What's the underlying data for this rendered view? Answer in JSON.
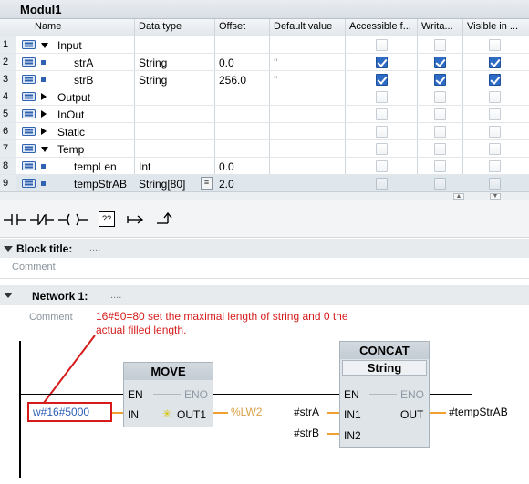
{
  "block": {
    "title": "Modul1"
  },
  "columns": [
    "Name",
    "Data type",
    "Offset",
    "Default value",
    "Accessible f...",
    "Writa...",
    "Visible in ..."
  ],
  "rows": [
    {
      "num": "1",
      "name": "Input",
      "type": "",
      "offset": "",
      "default": "",
      "tree": "down",
      "level": 0,
      "checks": [
        "off",
        "off",
        "off"
      ]
    },
    {
      "num": "2",
      "name": "strA",
      "type": "String",
      "offset": "0.0",
      "default": "''",
      "tree": "",
      "level": 1,
      "checks": [
        "on",
        "on",
        "on"
      ]
    },
    {
      "num": "3",
      "name": "strB",
      "type": "String",
      "offset": "256.0",
      "default": "''",
      "tree": "",
      "level": 1,
      "checks": [
        "on",
        "on",
        "on"
      ]
    },
    {
      "num": "4",
      "name": "Output",
      "type": "",
      "offset": "",
      "default": "",
      "tree": "right",
      "level": 0,
      "checks": [
        "off",
        "off",
        "off"
      ]
    },
    {
      "num": "5",
      "name": "InOut",
      "type": "",
      "offset": "",
      "default": "",
      "tree": "right",
      "level": 0,
      "checks": [
        "off",
        "off",
        "off"
      ]
    },
    {
      "num": "6",
      "name": "Static",
      "type": "",
      "offset": "",
      "default": "",
      "tree": "right",
      "level": 0,
      "checks": [
        "off",
        "off",
        "off"
      ]
    },
    {
      "num": "7",
      "name": "Temp",
      "type": "",
      "offset": "",
      "default": "",
      "tree": "down",
      "level": 0,
      "checks": [
        "off",
        "off",
        "off"
      ]
    },
    {
      "num": "8",
      "name": "tempLen",
      "type": "Int",
      "offset": "0.0",
      "default": "",
      "tree": "",
      "level": 1,
      "checks": [
        "off",
        "off",
        "off"
      ]
    },
    {
      "num": "9",
      "name": "tempStrAB",
      "type": "String[80]",
      "offset": "2.0",
      "default": "",
      "tree": "",
      "level": 1,
      "checks": [
        "off",
        "off",
        "off"
      ]
    }
  ],
  "toolbar": {
    "icons": [
      "no-contact-icon",
      "nc-contact-icon",
      "coil-icon",
      "empty-box-icon",
      "open-branch-icon",
      "close-branch-icon"
    ],
    "empty_box_label": "??"
  },
  "block_title": {
    "label": "Block title:",
    "dots": ".....",
    "comment": "Comment"
  },
  "network": {
    "label": "Network 1:",
    "dots": ".....",
    "comment": "Comment"
  },
  "annotation": "16#50=80 set the maximal length of string and 0 the actual filled length.",
  "move_box": {
    "title": "MOVE",
    "en": "EN",
    "eno": "ENO",
    "in": "IN",
    "out1": "OUT1",
    "in_value": "w#16#5000",
    "out1_value": "%LW2"
  },
  "concat_box": {
    "title": "CONCAT",
    "type": "String",
    "en": "EN",
    "eno": "ENO",
    "in1": "IN1",
    "in2": "IN2",
    "out": "OUT",
    "in1_value": "#strA",
    "in2_value": "#strB",
    "out_value": "#tempStrAB"
  },
  "colors": {
    "annotation": "#d61b1b",
    "checkbox_on": "#2e6bc4",
    "wire_inactive": "#f0a030",
    "operand_blue": "#2d5fb4"
  }
}
